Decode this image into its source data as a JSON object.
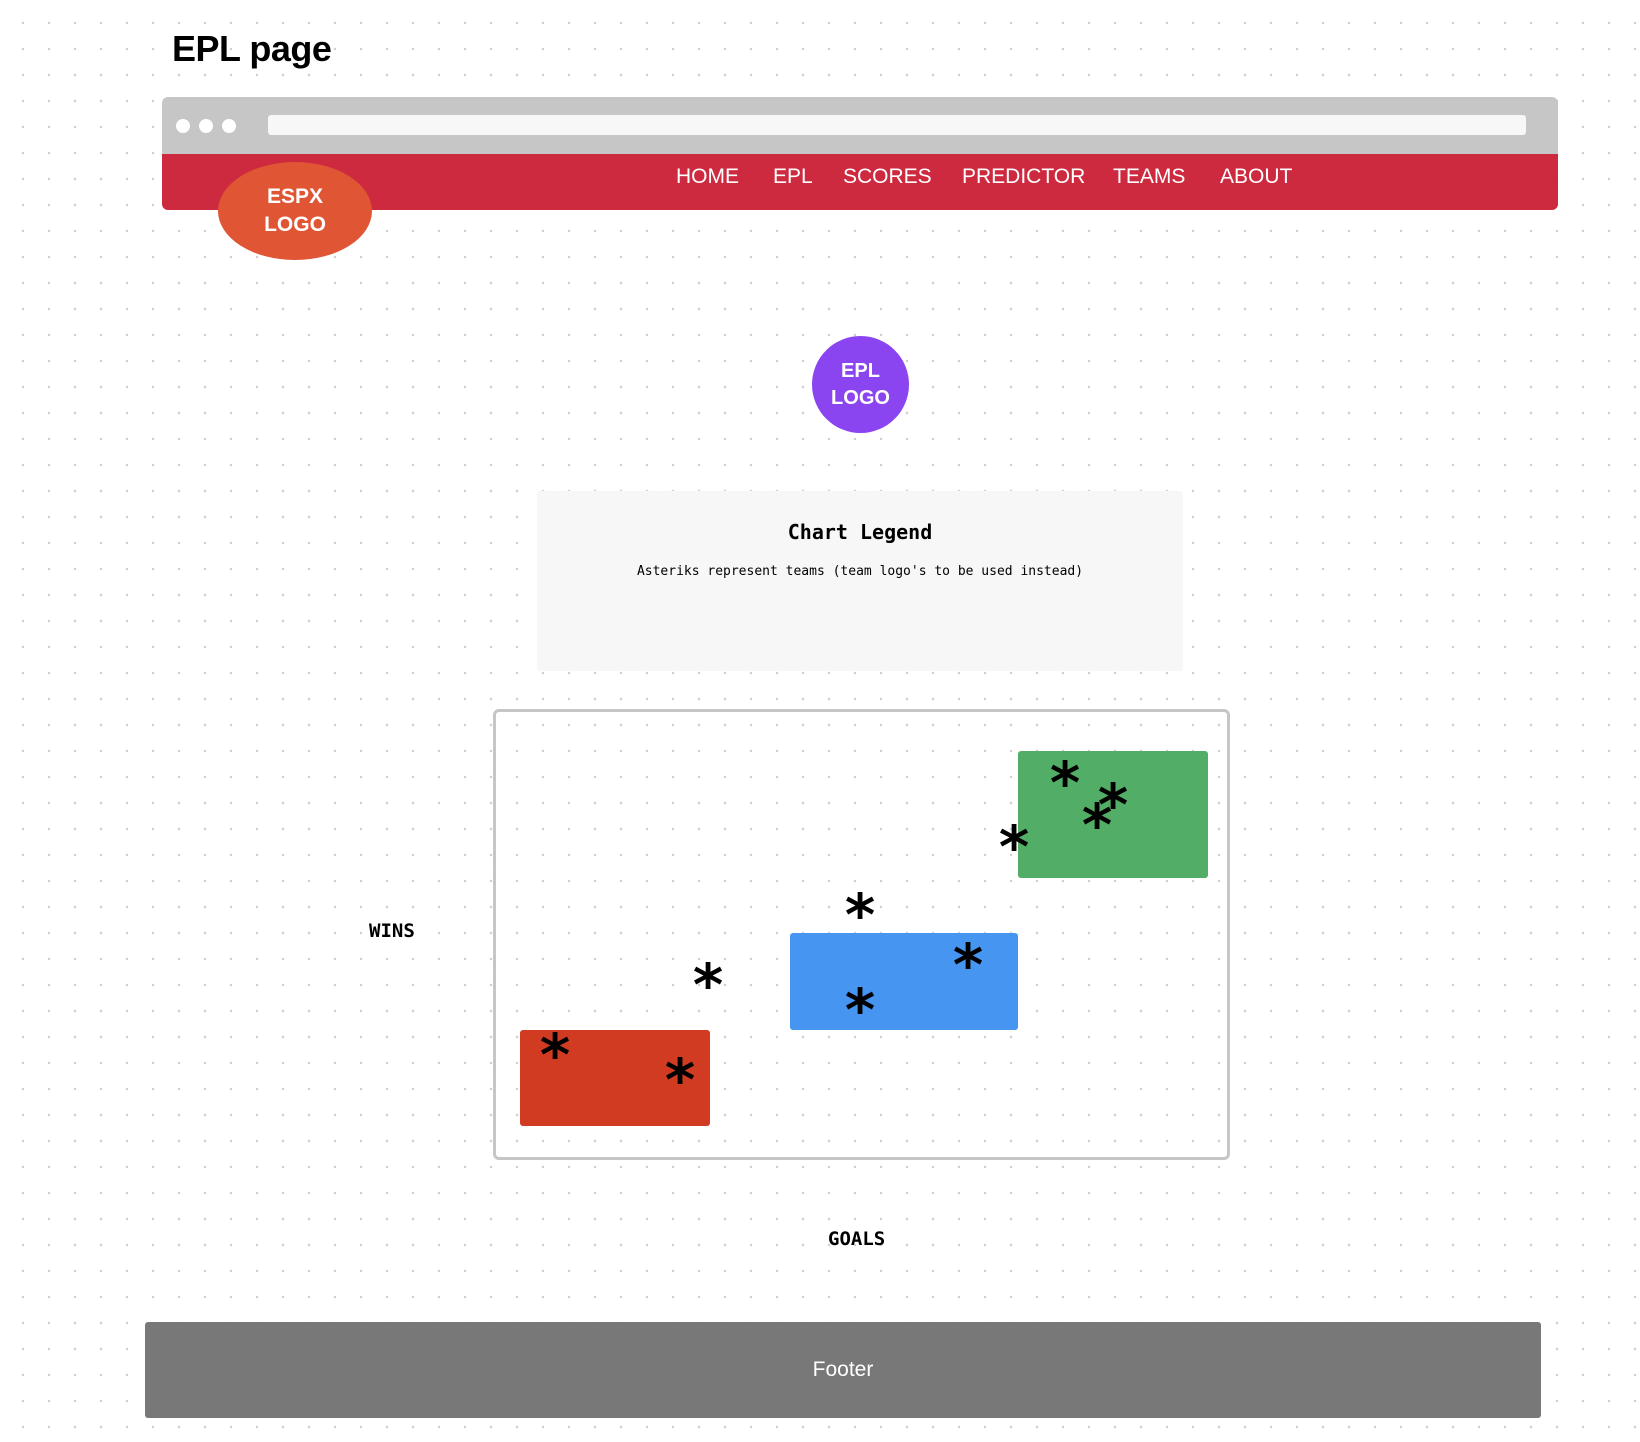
{
  "page": {
    "title": "EPL page"
  },
  "nav": {
    "items": [
      {
        "label": "HOME"
      },
      {
        "label": "EPL"
      },
      {
        "label": "SCORES"
      },
      {
        "label": "PREDICTOR"
      },
      {
        "label": "TEAMS"
      },
      {
        "label": "ABOUT"
      }
    ]
  },
  "logos": {
    "espx_line1": "ESPX",
    "espx_line2": "LOGO",
    "epl_line1": "EPL",
    "epl_line2": "LOGO"
  },
  "legend": {
    "title": "Chart Legend",
    "subtitle": "Asteriks represent teams (team logo's to be used instead)"
  },
  "chart_data": {
    "type": "scatter",
    "xlabel": "GOALS",
    "ylabel": "WINS",
    "marker": "*",
    "colors": {
      "low": "#d03b22",
      "mid": "#4595f1",
      "high": "#52ad66"
    }
  },
  "footer": {
    "label": "Footer"
  }
}
